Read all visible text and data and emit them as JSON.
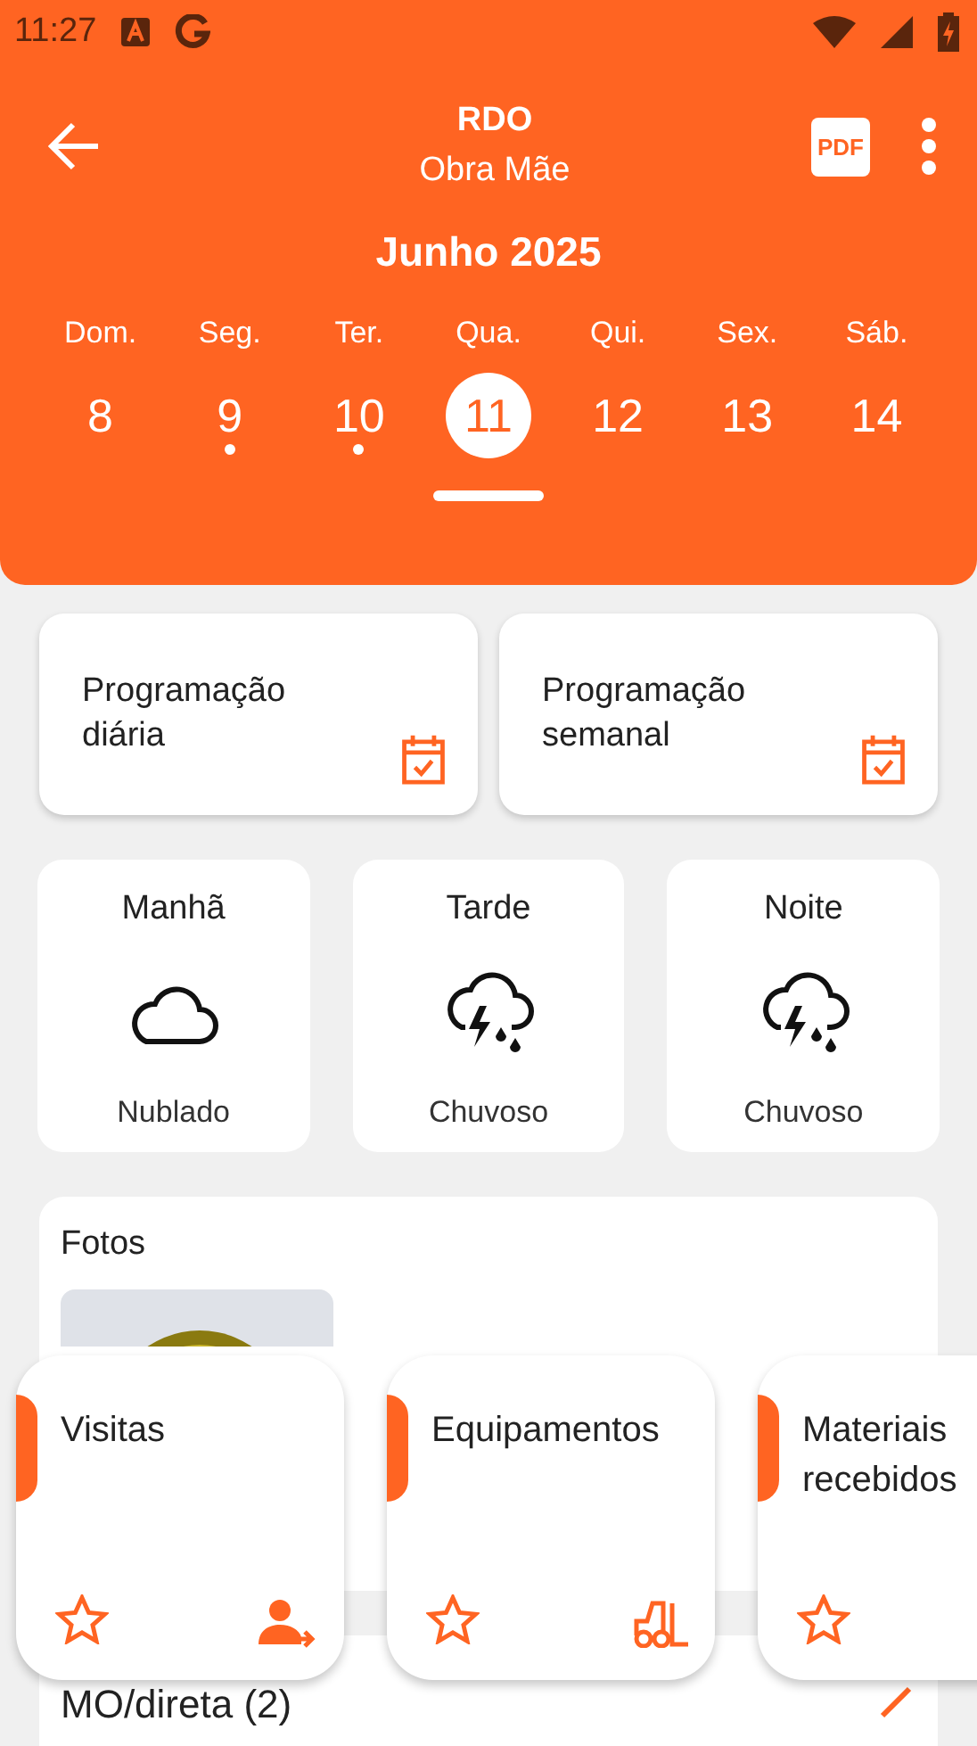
{
  "status_bar": {
    "time": "11:27"
  },
  "header": {
    "title": "RDO",
    "subtitle": "Obra Mãe",
    "pdf_label": "PDF",
    "month": "Junho 2025"
  },
  "days": [
    {
      "weekday": "Dom.",
      "day": "8",
      "selected": false,
      "has_entry": false
    },
    {
      "weekday": "Seg.",
      "day": "9",
      "selected": false,
      "has_entry": true
    },
    {
      "weekday": "Ter.",
      "day": "10",
      "selected": false,
      "has_entry": true
    },
    {
      "weekday": "Qua.",
      "day": "11",
      "selected": true,
      "has_entry": false
    },
    {
      "weekday": "Qui.",
      "day": "12",
      "selected": false,
      "has_entry": false
    },
    {
      "weekday": "Sex.",
      "day": "13",
      "selected": false,
      "has_entry": false
    },
    {
      "weekday": "Sáb.",
      "day": "14",
      "selected": false,
      "has_entry": false
    }
  ],
  "programs": [
    {
      "label": "Programação diária"
    },
    {
      "label": "Programação semanal"
    }
  ],
  "weather": [
    {
      "period": "Manhã",
      "kind": "cloudy",
      "condition": "Nublado"
    },
    {
      "period": "Tarde",
      "kind": "rainy",
      "condition": "Chuvoso"
    },
    {
      "period": "Noite",
      "kind": "rainy",
      "condition": "Chuvoso"
    }
  ],
  "photos": {
    "title": "Fotos"
  },
  "labor": {
    "title": "MO/direta (2)"
  },
  "shortcuts": [
    {
      "label": "Visitas",
      "kind": "visits"
    },
    {
      "label": "Equipamentos",
      "kind": "equipment"
    },
    {
      "label": "Materiais recebidos",
      "kind": "materials"
    }
  ]
}
